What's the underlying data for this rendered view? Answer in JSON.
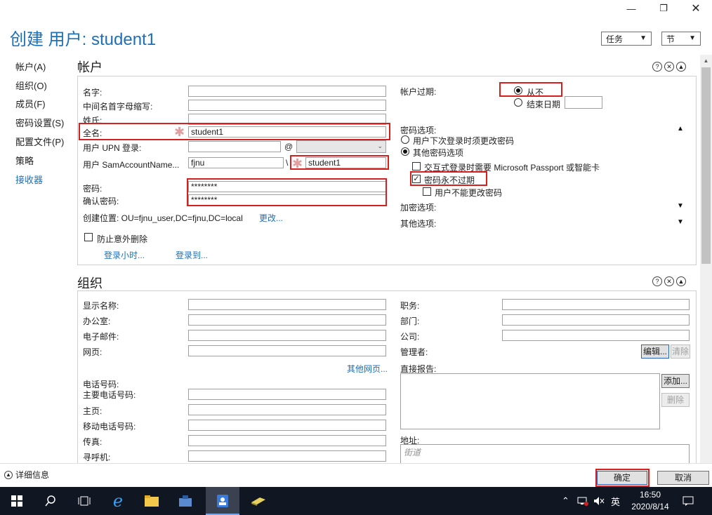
{
  "window": {
    "title": "创建 用户: student1",
    "min_icon": "minimize-icon",
    "max_icon": "restore-icon",
    "close_icon": "close-icon",
    "menu_tasks": "任务",
    "menu_sections": "节"
  },
  "nav": {
    "items": [
      "帐户(A)",
      "组织(O)",
      "成员(F)",
      "密码设置(S)",
      "配置文件(P)",
      "策略",
      "接收器"
    ]
  },
  "account": {
    "title": "帐户",
    "first_name_label": "名字:",
    "initials_label": "中间名首字母缩写:",
    "last_name_label": "姓氏:",
    "full_name_label": "全名:",
    "full_name_value": "student1",
    "upn_label": "用户 UPN 登录:",
    "at_sign": "@",
    "sam_label": "用户 SamAccountName...",
    "sam_domain": "fjnu",
    "sam_sep": "\\",
    "sam_value": "student1",
    "password_label": "密码:",
    "password_value": "********",
    "confirm_label": "确认密码:",
    "confirm_value": "********",
    "create_in_label": "创建位置: OU=fjnu_user,DC=fjnu,DC=local",
    "change_link": "更改...",
    "protect_label": "防止意外删除",
    "logon_hours_link": "登录小时...",
    "logon_to_link": "登录到...",
    "expire_label": "帐户过期:",
    "never_label": "从不",
    "end_date_label": "结束日期",
    "pwd_options_label": "密码选项:",
    "must_change_label": "用户下次登录时须更改密码",
    "other_pwd_label": "其他密码选项",
    "smartcard_label": "交互式登录时需要 Microsoft Passport 或智能卡",
    "never_expires_label": "密码永不过期",
    "cannot_change_label": "用户不能更改密码",
    "encryption_label": "加密选项:",
    "other_options_label": "其他选项:"
  },
  "org": {
    "title": "组织",
    "display_name_label": "显示名称:",
    "office_label": "办公室:",
    "email_label": "电子邮件:",
    "web_label": "网页:",
    "other_web_link": "其他网页...",
    "phone_label": "电话号码:",
    "main_phone_label": "主要电话号码:",
    "home_label": "主页:",
    "mobile_label": "移动电话号码:",
    "fax_label": "传真:",
    "pager_label": "寻呼机:",
    "job_label": "职务:",
    "dept_label": "部门:",
    "company_label": "公司:",
    "manager_label": "管理者:",
    "edit_btn": "编辑...",
    "clear_btn": "清除",
    "reports_label": "直接报告:",
    "add_btn": "添加...",
    "remove_btn": "删除",
    "address_label": "地址:",
    "street_placeholder": "街道"
  },
  "footer": {
    "more_info": "详细信息",
    "ok": "确定",
    "cancel": "取消"
  },
  "taskbar": {
    "ime_label": "英",
    "time": "16:50",
    "date": "2020/8/14"
  }
}
